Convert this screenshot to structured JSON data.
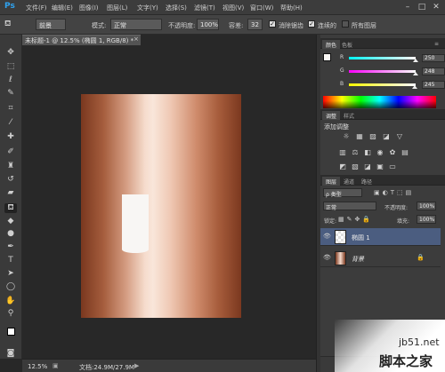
{
  "app": {
    "logo": "Ps"
  },
  "menu": [
    "文件(F)",
    "编辑(E)",
    "图像(I)",
    "图层(L)",
    "文字(Y)",
    "选择(S)",
    "滤镜(T)",
    "视图(V)",
    "窗口(W)",
    "帮助(H)"
  ],
  "window_controls": [
    "–",
    "□",
    "✕"
  ],
  "options": {
    "mode_label": "模式:",
    "mode_value": "正常",
    "opacity_label": "不透明度:",
    "opacity_value": "100%",
    "tolerance_label": "容差:",
    "tolerance_value": "32",
    "antialias_label": "消除锯齿",
    "contiguous_label": "连续的",
    "all_layers_label": "所有图层",
    "swatch_mode": "前景"
  },
  "document": {
    "tab_label": "未标题-1 @ 12.5% (椭圆 1, RGB/8) *",
    "close": "×",
    "zoom": "12.5%",
    "doc_info": "文档:24.9M/27.9M"
  },
  "color_panel": {
    "tabs": [
      "颜色",
      "色板"
    ],
    "channels": [
      {
        "name": "R",
        "value": "250"
      },
      {
        "name": "G",
        "value": "248"
      },
      {
        "name": "B",
        "value": "245"
      }
    ]
  },
  "adjustments_panel": {
    "tabs": [
      "调整",
      "样式"
    ],
    "title": "添加调整"
  },
  "layers_panel": {
    "tabs": [
      "图层",
      "通道",
      "路径"
    ],
    "filter_label": "ρ 类型",
    "blend_mode": "正常",
    "opacity_label": "不透明度:",
    "opacity_value": "100%",
    "lock_label": "锁定:",
    "fill_label": "填充:",
    "fill_value": "100%",
    "layers": [
      {
        "name": "椭圆 1",
        "selected": true
      },
      {
        "name": "背景",
        "selected": false
      }
    ]
  },
  "watermark": {
    "line1": "jb51.net",
    "line2": "脚本之家"
  },
  "colors": {
    "accent": "#2fa3f0",
    "selected_layer": "#4b5d80"
  }
}
